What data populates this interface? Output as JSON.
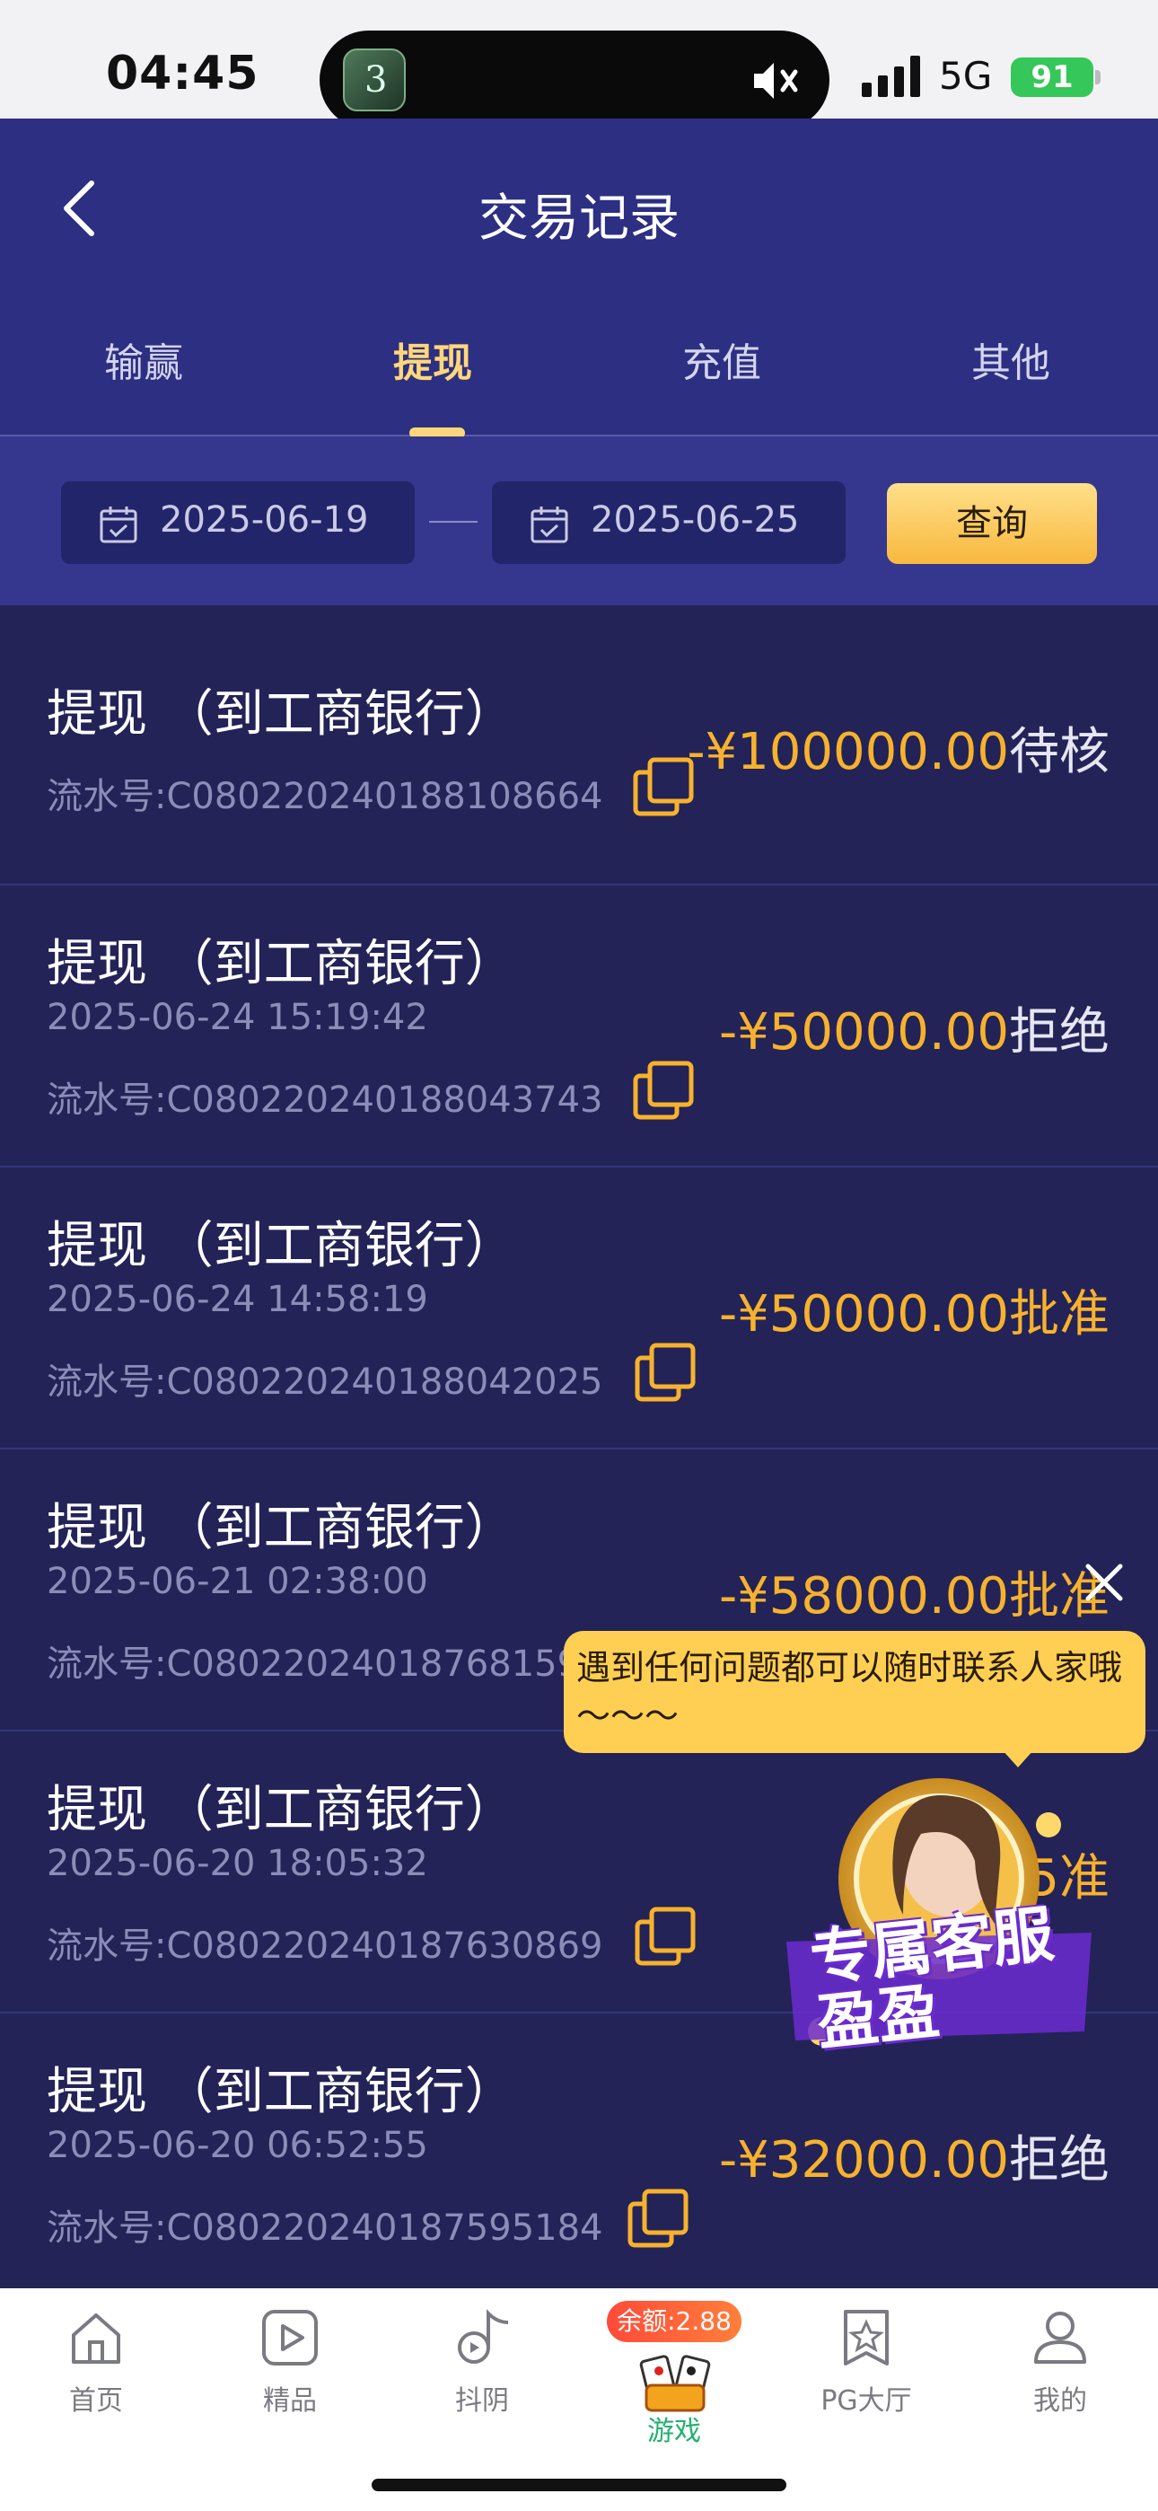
{
  "status_bar": {
    "time": "04:45",
    "network": "5G",
    "battery": "91"
  },
  "header": {
    "title": "交易记录"
  },
  "tabs": [
    {
      "label": "输赢",
      "active": false
    },
    {
      "label": "提现",
      "active": true
    },
    {
      "label": "充值",
      "active": false
    },
    {
      "label": "其他",
      "active": false
    }
  ],
  "filter": {
    "start_date": "2025-06-19",
    "end_date": "2025-06-25",
    "query_label": "查询"
  },
  "records": [
    {
      "title": "提现 （到工商银行）",
      "time": "",
      "serial": "流水号:C080220240188108664",
      "amount": "-¥100000.00",
      "status": "待核"
    },
    {
      "title": "提现 （到工商银行）",
      "time": "2025-06-24 15:19:42",
      "serial": "流水号:C080220240188043743",
      "amount": "-¥50000.00",
      "status": "拒绝"
    },
    {
      "title": "提现 （到工商银行）",
      "time": "2025-06-24 14:58:19",
      "serial": "流水号:C080220240188042025",
      "amount": "-¥50000.00",
      "status": "批准"
    },
    {
      "title": "提现 （到工商银行）",
      "time": "2025-06-21 02:38:00",
      "serial": "流水号:C08022024018768159",
      "amount": "-¥58000.00",
      "status": "批准"
    },
    {
      "title": "提现 （到工商银行）",
      "time": "2025-06-20 18:05:32",
      "serial": "流水号:C080220240187630869",
      "amount": "-¥5",
      "status": "准"
    },
    {
      "title": "提现 （到工商银行）",
      "time": "2025-06-20 06:52:55",
      "serial": "流水号:C080220240187595184",
      "amount": "-¥32000.00",
      "status": "拒绝"
    }
  ],
  "support_popup": {
    "message": "遇到任何问题都可以随时联系人家哦～～～",
    "badge_text": "专属客服盈盈"
  },
  "bottom_nav": {
    "items": [
      {
        "label": "首页",
        "icon": "home-icon"
      },
      {
        "label": "精品",
        "icon": "play-icon"
      },
      {
        "label": "抖阴",
        "icon": "music-note-icon"
      },
      {
        "label": "游戏",
        "icon": "cards-icon",
        "active": true
      },
      {
        "label": "PG大厅",
        "icon": "star-badge-icon"
      },
      {
        "label": "我的",
        "icon": "user-icon"
      }
    ],
    "balance_badge": "余额:2.88"
  },
  "colors": {
    "header_bg": "#2d2f82",
    "list_bg": "#232357",
    "accent": "#f7b22d",
    "tab_active": "#ffd77a"
  }
}
